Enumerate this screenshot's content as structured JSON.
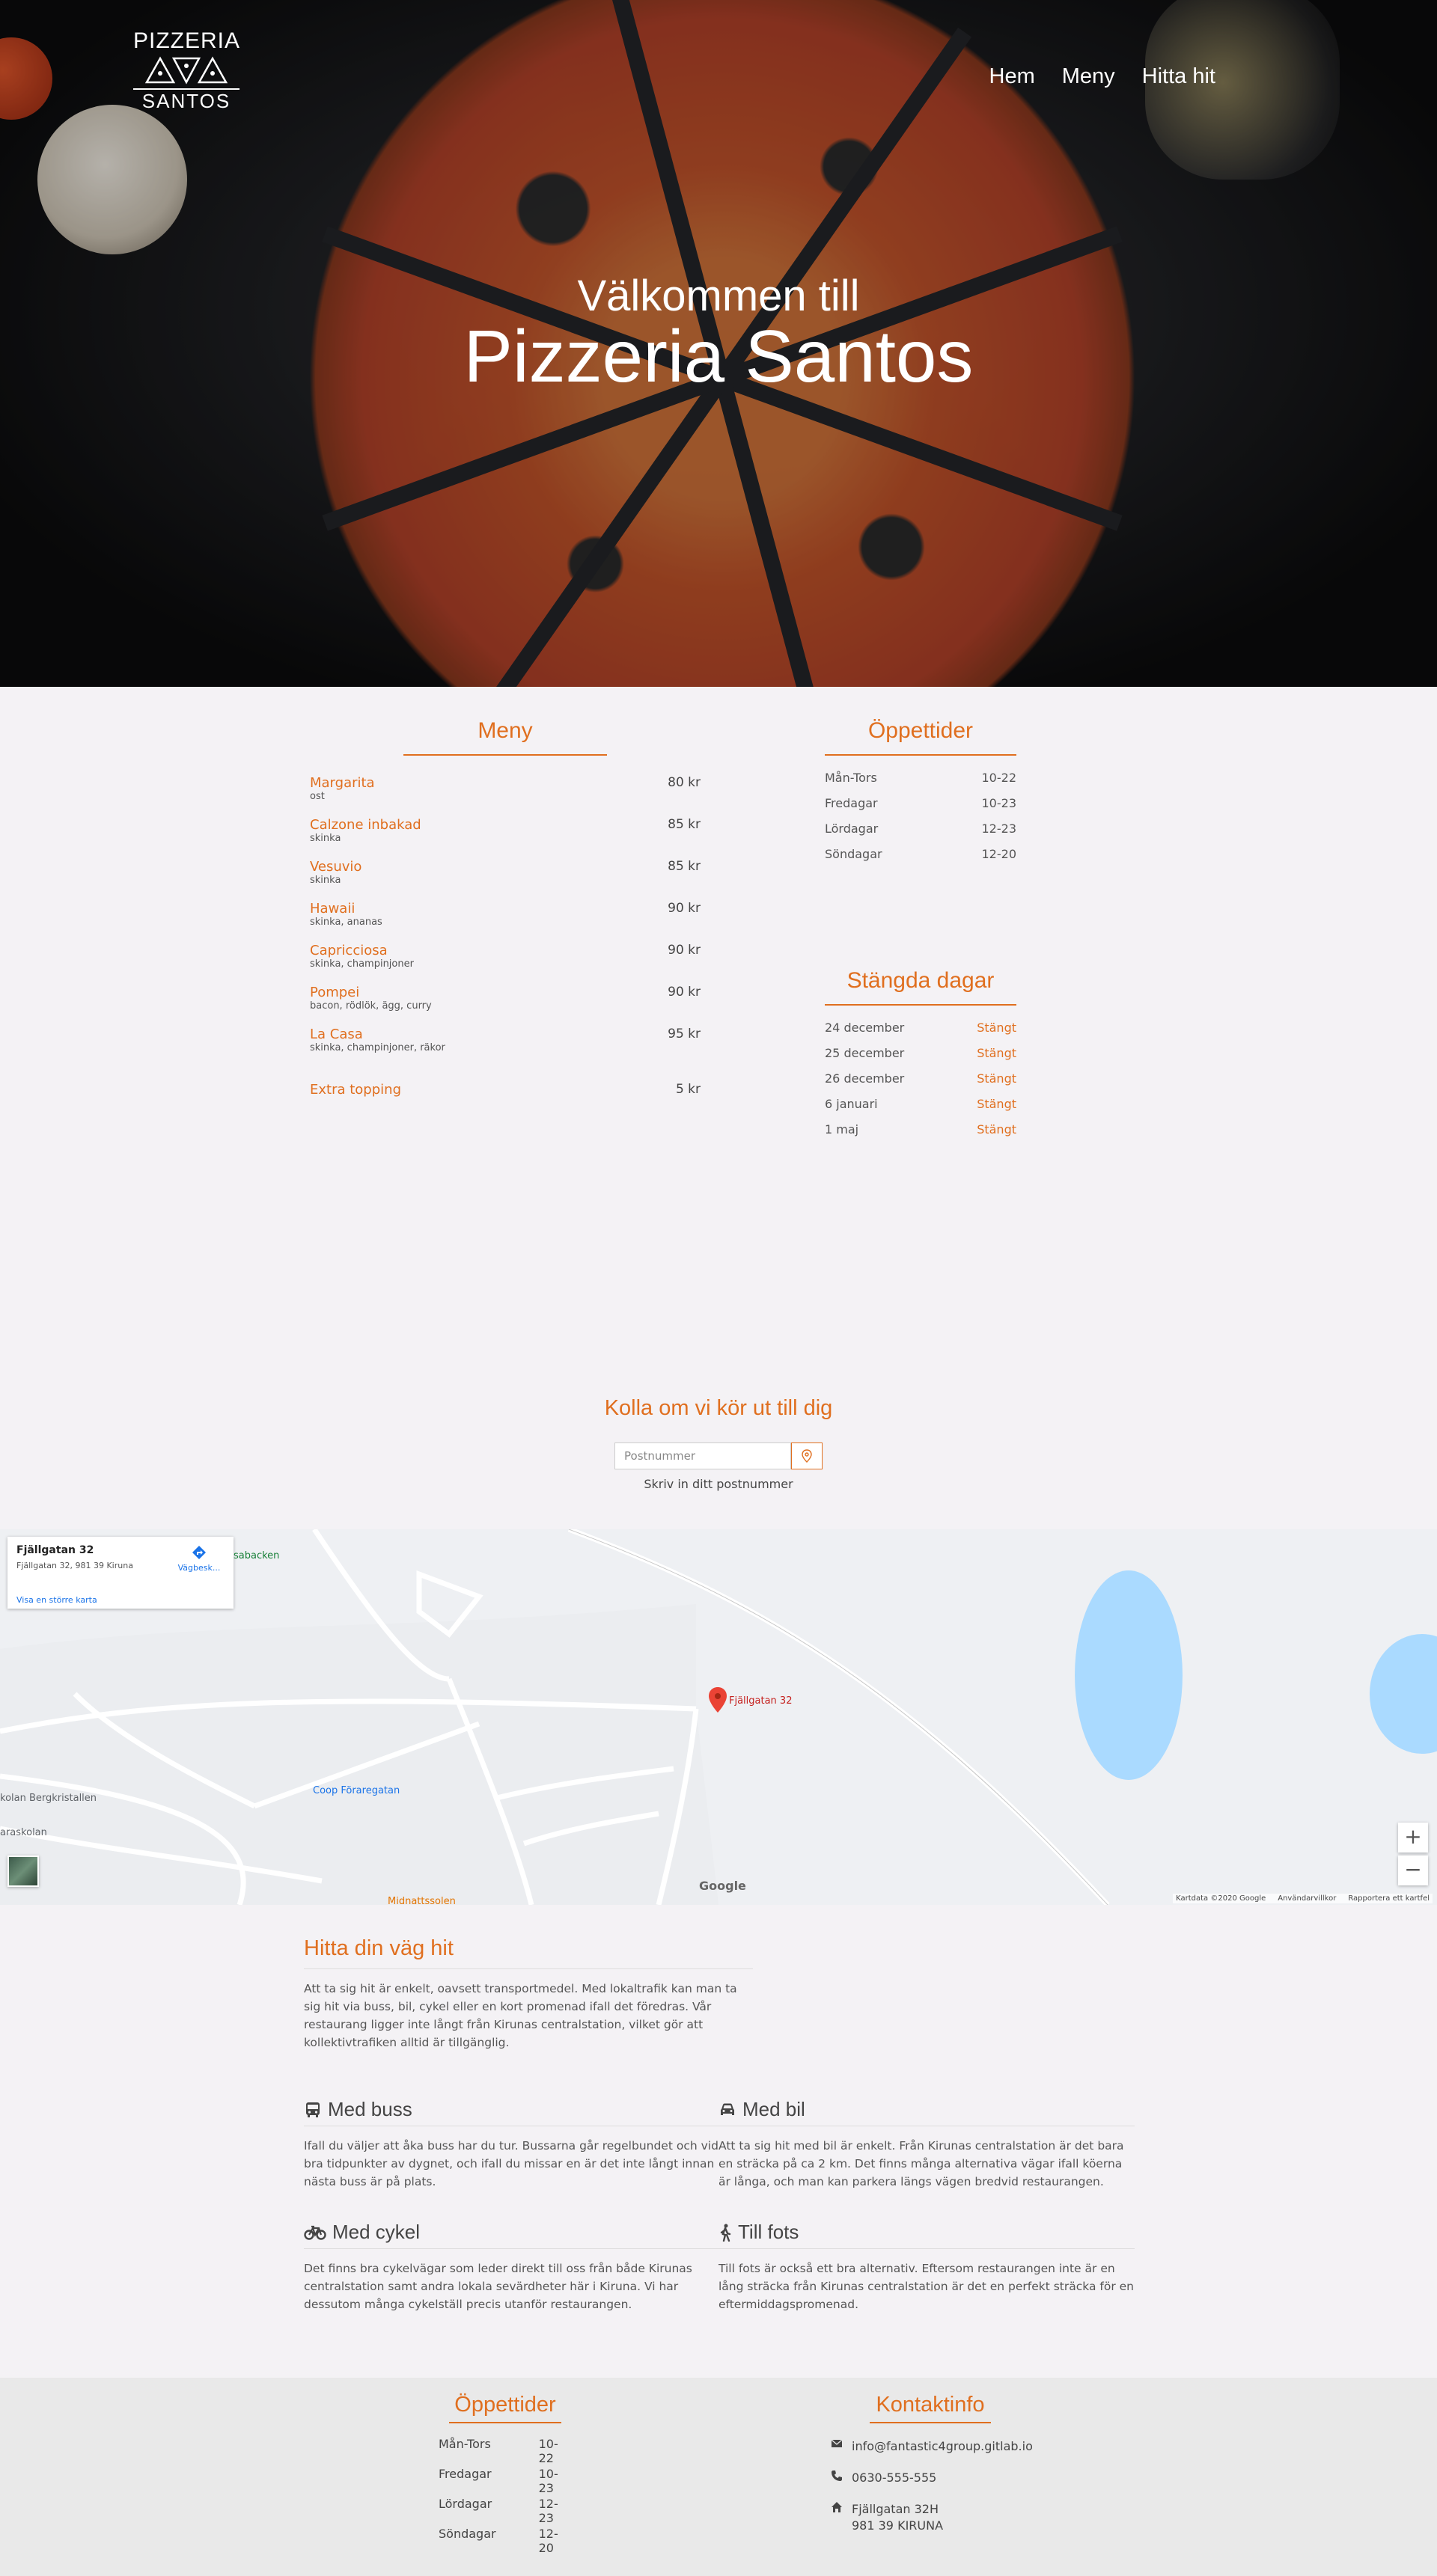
{
  "logo": {
    "line1": "PIZZERIA",
    "line2": "SANTOS"
  },
  "nav": {
    "items": [
      "Hem",
      "Meny",
      "Hitta hit"
    ]
  },
  "hero": {
    "subtitle": "Välkommen till",
    "title": "Pizzeria Santos"
  },
  "menu": {
    "title": "Meny",
    "items": [
      {
        "name": "Margarita",
        "desc": "ost",
        "price": "80 kr"
      },
      {
        "name": "Calzone inbakad",
        "desc": "skinka",
        "price": "85 kr"
      },
      {
        "name": "Vesuvio",
        "desc": "skinka",
        "price": "85 kr"
      },
      {
        "name": "Hawaii",
        "desc": "skinka, ananas",
        "price": "90 kr"
      },
      {
        "name": "Capricciosa",
        "desc": "skinka, champinjoner",
        "price": "90 kr"
      },
      {
        "name": "Pompei",
        "desc": "bacon, rödlök, ägg, curry",
        "price": "90 kr"
      },
      {
        "name": "La Casa",
        "desc": "skinka, champinjoner, räkor",
        "price": "95 kr"
      }
    ],
    "extra": {
      "name": "Extra topping",
      "price": "5 kr"
    }
  },
  "hours": {
    "title": "Öppettider",
    "rows": [
      {
        "day": "Mån-Tors",
        "time": "10-22"
      },
      {
        "day": "Fredagar",
        "time": "10-23"
      },
      {
        "day": "Lördagar",
        "time": "12-23"
      },
      {
        "day": "Söndagar",
        "time": "12-20"
      }
    ]
  },
  "closed": {
    "title": "Stängda dagar",
    "rows": [
      {
        "day": "24 december",
        "status": "Stängt"
      },
      {
        "day": "25 december",
        "status": "Stängt"
      },
      {
        "day": "26 december",
        "status": "Stängt"
      },
      {
        "day": "6 januari",
        "status": "Stängt"
      },
      {
        "day": "1 maj",
        "status": "Stängt"
      }
    ]
  },
  "delivery": {
    "title": "Kolla om vi kör ut till dig",
    "placeholder": "Postnummer",
    "hint": "Skriv in ditt postnummer"
  },
  "map": {
    "card_title": "Fjällgatan 32",
    "card_address": "Fjällgatan 32, 981 39 Kiruna",
    "card_link": "Visa en större karta",
    "card_directions": "Vägbesk...",
    "marker_label": "Fjällgatan 32",
    "place_1": "Coop Föraregatan",
    "place_2": "kolan Bergkristallen",
    "place_3": "araskolan",
    "place_4": "sabacken",
    "place_5": "Midnattssolen",
    "google": "Google",
    "footer_1": "Kartdata ©2020 Google",
    "footer_2": "Användarvillkor",
    "footer_3": "Rapportera ett kartfel",
    "zoom_in": "+",
    "zoom_out": "−"
  },
  "find": {
    "title": "Hitta din väg hit",
    "text": "Att ta sig hit är enkelt, oavsett transportmedel. Med lokaltrafik kan man ta sig hit via buss, bil, cykel eller en kort promenad ifall det föredras. Vår restaurang ligger inte långt från Kirunas centralstation, vilket gör att kollektivtrafiken alltid är tillgänglig."
  },
  "transport": [
    {
      "title": "Med buss",
      "icon": "bus-icon",
      "text": "Ifall du väljer att åka buss har du tur. Bussarna går regelbundet och vid bra tidpunkter av dygnet, och ifall du missar en är det inte långt innan nästa buss är på plats."
    },
    {
      "title": "Med bil",
      "icon": "car-icon",
      "text": "Att ta sig hit med bil är enkelt. Från Kirunas centralstation är det bara en sträcka på ca 2 km. Det finns många alternativa vägar ifall köerna är långa, och man kan parkera längs vägen bredvid restaurangen."
    },
    {
      "title": "Med cykel",
      "icon": "bicycle-icon",
      "text": "Det finns bra cykelvägar som leder direkt till oss från både Kirunas centralstation samt andra lokala sevärdheter här i Kiruna. Vi har dessutom många cykelställ precis utanför restaurangen."
    },
    {
      "title": "Till fots",
      "icon": "walking-icon",
      "text": "Till fots är också ett bra alternativ. Eftersom restaurangen inte är en lång sträcka från Kirunas centralstation är det en perfekt sträcka för en eftermiddagspromenad."
    }
  ],
  "footer": {
    "hours_title": "Öppettider",
    "hours": [
      {
        "day": "Mån-Tors",
        "time": "10-22"
      },
      {
        "day": "Fredagar",
        "time": "10-23"
      },
      {
        "day": "Lördagar",
        "time": "12-23"
      },
      {
        "day": "Söndagar",
        "time": "12-20"
      }
    ],
    "contact_title": "Kontaktinfo",
    "email": "info@fantastic4group.gitlab.io",
    "phone": "0630-555-555",
    "address_1": "Fjällgatan 32H",
    "address_2": "981 39 KIRUNA"
  },
  "colors": {
    "accent": "#e06f1f",
    "background": "#f4f2f5",
    "footer": "#e9e9e9"
  }
}
